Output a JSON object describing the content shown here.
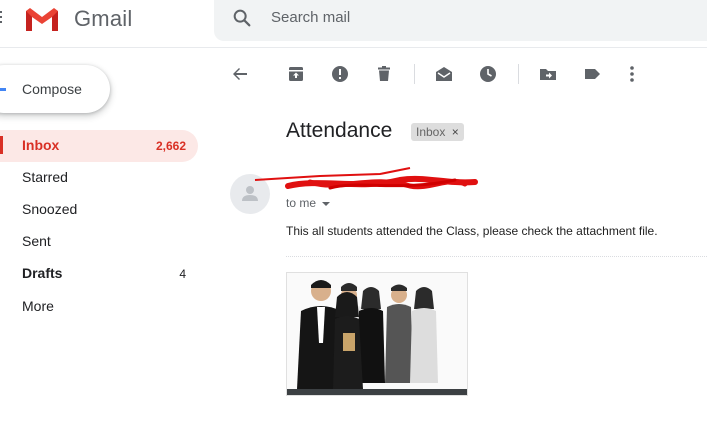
{
  "header": {
    "app_name": "Gmail",
    "search_placeholder": "Search mail"
  },
  "sidebar": {
    "compose_label": "Compose",
    "items": [
      {
        "label": "Inbox",
        "count": "2,662",
        "active": true
      },
      {
        "label": "Starred",
        "count": ""
      },
      {
        "label": "Snoozed",
        "count": ""
      },
      {
        "label": "Sent",
        "count": ""
      },
      {
        "label": "Drafts",
        "count": "4"
      },
      {
        "label": "More",
        "count": ""
      }
    ]
  },
  "toolbar": {
    "icons": [
      "back-icon",
      "archive-icon",
      "report-spam-icon",
      "delete-icon",
      "mark-unread-icon",
      "snooze-icon",
      "move-to-icon",
      "label-icon",
      "more-icon"
    ]
  },
  "message": {
    "subject": "Attendance",
    "label_chip": "Inbox",
    "recipient_line": "to me",
    "body": "This all students attended the Class, please check the attachment file."
  },
  "colors": {
    "brand_red": "#d93025",
    "active_bg": "#fce8e6",
    "accent_blue": "#4285f4",
    "icon_gray": "#5f6368"
  }
}
